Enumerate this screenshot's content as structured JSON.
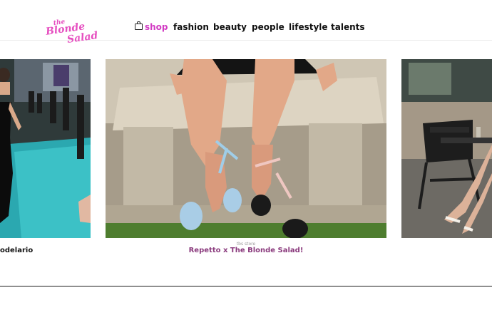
{
  "brand": {
    "logo_line1": "the",
    "logo_line2": "Blonde",
    "logo_line3": "Salad",
    "color": "#e64fc0"
  },
  "nav": {
    "items": [
      {
        "label": "shop",
        "icon": "shopping-bag-icon",
        "active": true
      },
      {
        "label": "fashion"
      },
      {
        "label": "beauty"
      },
      {
        "label": "people"
      },
      {
        "label": "lifestyle"
      },
      {
        "label": "talents"
      }
    ],
    "active_color": "#d23cc3"
  },
  "carousel": {
    "left": {
      "caption": "odelario"
    },
    "center": {
      "tag": "tbs store",
      "title": "Repetto x The Blonde Salad!"
    },
    "right": {}
  },
  "colors": {
    "title_accent": "#8a3a7d"
  }
}
